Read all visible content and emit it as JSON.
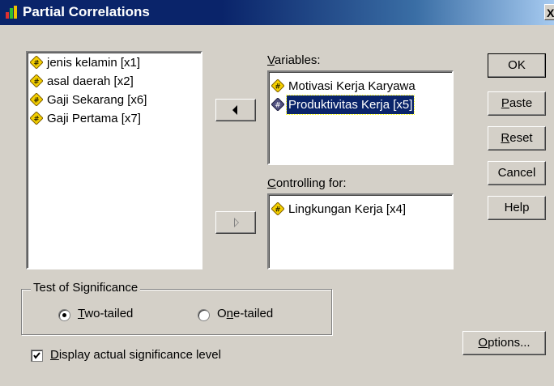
{
  "window": {
    "title": "Partial Correlations",
    "close_label": "X"
  },
  "source_list": {
    "items": [
      {
        "label": "jenis kelamin [x1]"
      },
      {
        "label": "asal daerah [x2]"
      },
      {
        "label": "Gaji Sekarang [x6]"
      },
      {
        "label": "Gaji Pertama [x7]"
      }
    ]
  },
  "variables": {
    "label_first": "V",
    "label_rest": "ariables:",
    "items": [
      {
        "label": "Motivasi Kerja Karyawa",
        "selected": false
      },
      {
        "label": "Produktivitas Kerja [x5]",
        "selected": true
      }
    ]
  },
  "controlling": {
    "label_first": "C",
    "label_rest": "ontrolling for:",
    "items": [
      {
        "label": "Lingkungan Kerja [x4]"
      }
    ]
  },
  "buttons": {
    "ok": "OK",
    "paste_first": "P",
    "paste_rest": "aste",
    "reset_first": "R",
    "reset_rest": "eset",
    "cancel": "Cancel",
    "help": "Help",
    "options_first": "O",
    "options_rest": "ptions..."
  },
  "significance": {
    "legend": "Test of Significance",
    "two_first": "T",
    "two_rest": "wo-tailed",
    "one_pre": "O",
    "one_u": "n",
    "one_rest": "e-tailed",
    "selected": "two-tailed"
  },
  "display_actual": {
    "first": "D",
    "rest": "isplay actual significance level",
    "checked": true
  },
  "colors": {
    "titlebar": "#0a246a",
    "selection": "#0a246a",
    "face": "#d4d0c8"
  }
}
